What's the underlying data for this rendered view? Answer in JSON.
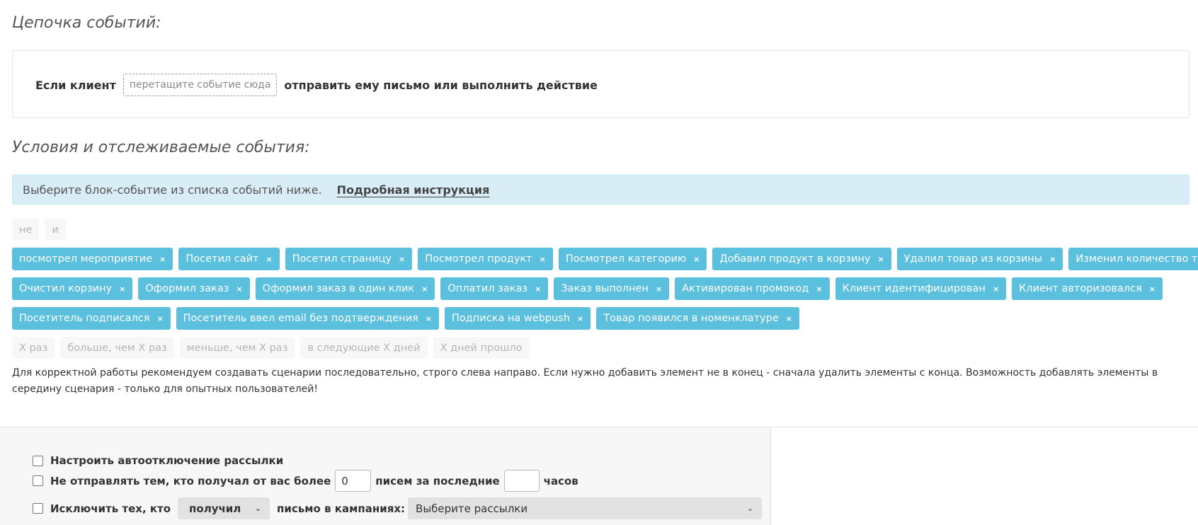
{
  "headings": {
    "chain": "Цепочка событий:",
    "conditions": "Условия и отслеживаемые события:"
  },
  "chain": {
    "prefix": "Если клиент",
    "drop_placeholder": "перетащите событие сюда",
    "suffix": "отправить ему письмо или выполнить действие"
  },
  "info": {
    "text": "Выберите блок-событие из списка событий ниже.",
    "link": "Подробная инструкция"
  },
  "operators": [
    "не",
    "и"
  ],
  "events_row1": [
    "посмотрел мероприятие",
    "Посетил сайт",
    "Посетил страницу",
    "Посмотрел продукт",
    "Посмотрел категорию",
    "Добавил продукт в корзину",
    "Удалил товар из корзины",
    "Изменил количество товара"
  ],
  "events_row2": [
    "Очистил корзину",
    "Оформил заказ",
    "Оформил заказ в один клик",
    "Оплатил заказ",
    "Заказ выполнен",
    "Активирован промокод",
    "Клиент идентифицирован",
    "Клиент авторизовался"
  ],
  "events_row3": [
    "Посетитель подписался",
    "Посетитель ввел email без подтверждения",
    "Подписка на webpush",
    "Товар появился в номенклатуре"
  ],
  "remove_glyph": "×",
  "modifiers": [
    "X раз",
    "больше, чем X раз",
    "меньше, чем X раз",
    "в следующие X дней",
    "X дней прошло"
  ],
  "note": "Для корректной работы рекомендуем создавать сценарии последовательно, строго слева направо. Если нужно добавить элемент не в конец - сначала удалить элементы с конца. Возможность добавлять элементы в середину сценария - только для опытных пользователей!",
  "settings": {
    "auto_disable": "Настроить автоотключение рассылки",
    "limit_prefix": "Не отправлять тем, кто получал от вас более",
    "limit_count": "0",
    "limit_middle": "писем за последние",
    "limit_hours": "",
    "limit_suffix": "часов",
    "exclude_prefix": "Исключить тех, кто",
    "exclude_action": "получил",
    "exclude_middle": "письмо в кампаниях:",
    "exclude_campaigns": "Выберите рассылки"
  }
}
